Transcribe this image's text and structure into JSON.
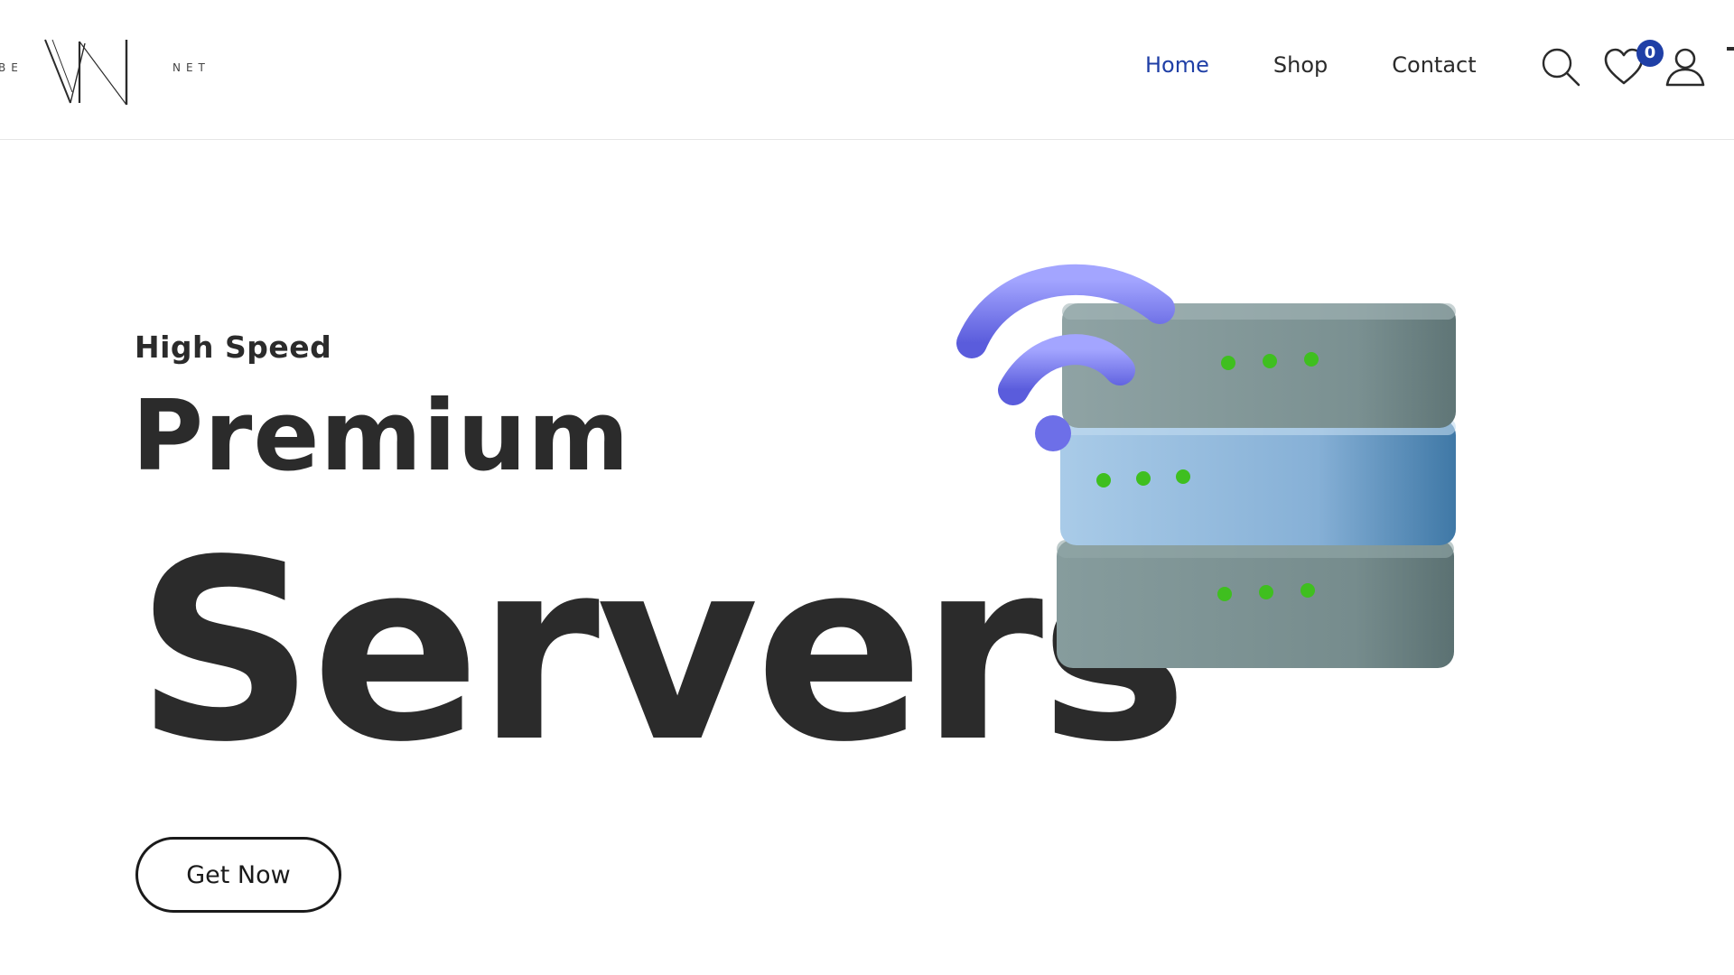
{
  "header": {
    "logo": {
      "left_text": "BE",
      "right_text": "NET",
      "mark_text": "VN"
    },
    "nav": [
      {
        "label": "Home",
        "active": true
      },
      {
        "label": "Shop",
        "active": false
      },
      {
        "label": "Contact",
        "active": false
      }
    ],
    "icons": {
      "search": "search-icon",
      "wishlist": "heart-icon",
      "account": "user-icon"
    },
    "wishlist_count": "0"
  },
  "hero": {
    "subtitle": "High Speed",
    "title_line1": "Premium",
    "title_line2": "Servers",
    "cta_label": "Get Now",
    "illustration": "server-rack-wifi-illustration"
  },
  "colors": {
    "accent": "#1f3fa6",
    "text": "#2b2b2b",
    "server_gray": "#7f9596",
    "server_blue": "#8ab4d8",
    "wifi": "#7b7df0",
    "led": "#3fbf1f"
  }
}
